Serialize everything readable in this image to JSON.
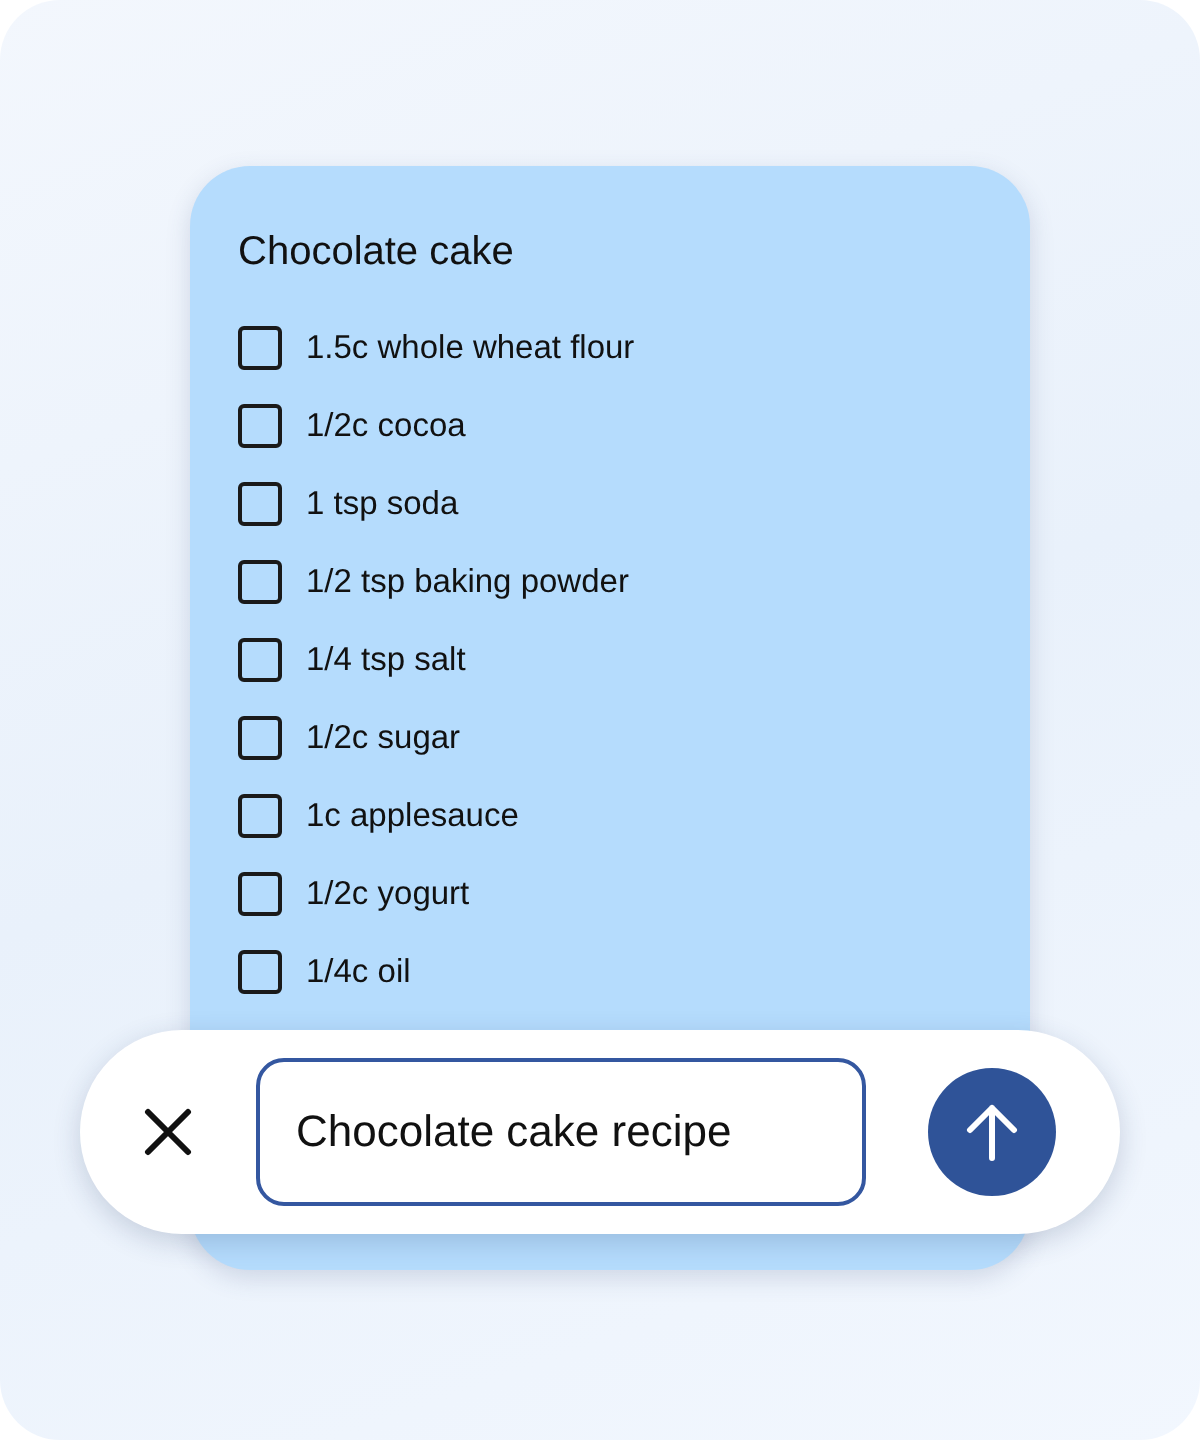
{
  "note": {
    "title": "Chocolate cake",
    "items": [
      {
        "label": "1.5c whole wheat flour",
        "checked": false
      },
      {
        "label": "1/2c cocoa",
        "checked": false
      },
      {
        "label": "1 tsp soda",
        "checked": false
      },
      {
        "label": "1/2 tsp baking powder",
        "checked": false
      },
      {
        "label": "1/4 tsp salt",
        "checked": false
      },
      {
        "label": "1/2c sugar",
        "checked": false
      },
      {
        "label": "1c applesauce",
        "checked": false
      },
      {
        "label": "1/2c yogurt",
        "checked": false
      },
      {
        "label": "1/4c oil",
        "checked": false
      }
    ]
  },
  "prompt_bar": {
    "value": "Chocolate cake recipe"
  }
}
